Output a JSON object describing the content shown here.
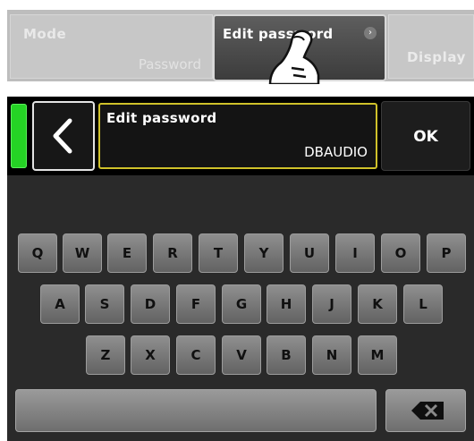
{
  "menu": {
    "mode_title": "Mode",
    "mode_value": "Password",
    "edit_title": "Edit password",
    "display_title": "Display"
  },
  "editor": {
    "field_label": "Edit password",
    "field_value": "DBAUDIO",
    "ok_label": "OK",
    "led_color": "#25d325"
  },
  "keyboard": {
    "row1": [
      "Q",
      "W",
      "E",
      "R",
      "T",
      "Y",
      "U",
      "I",
      "O",
      "P"
    ],
    "row2": [
      "A",
      "S",
      "D",
      "F",
      "G",
      "H",
      "J",
      "K",
      "L"
    ],
    "row3": [
      "Z",
      "X",
      "C",
      "V",
      "B",
      "N",
      "M"
    ]
  },
  "icons": {
    "back": "chevron-left-icon",
    "backspace": "backspace-icon",
    "edit_arrow": "chevron-right-icon",
    "hand": "pointing-hand-icon"
  }
}
